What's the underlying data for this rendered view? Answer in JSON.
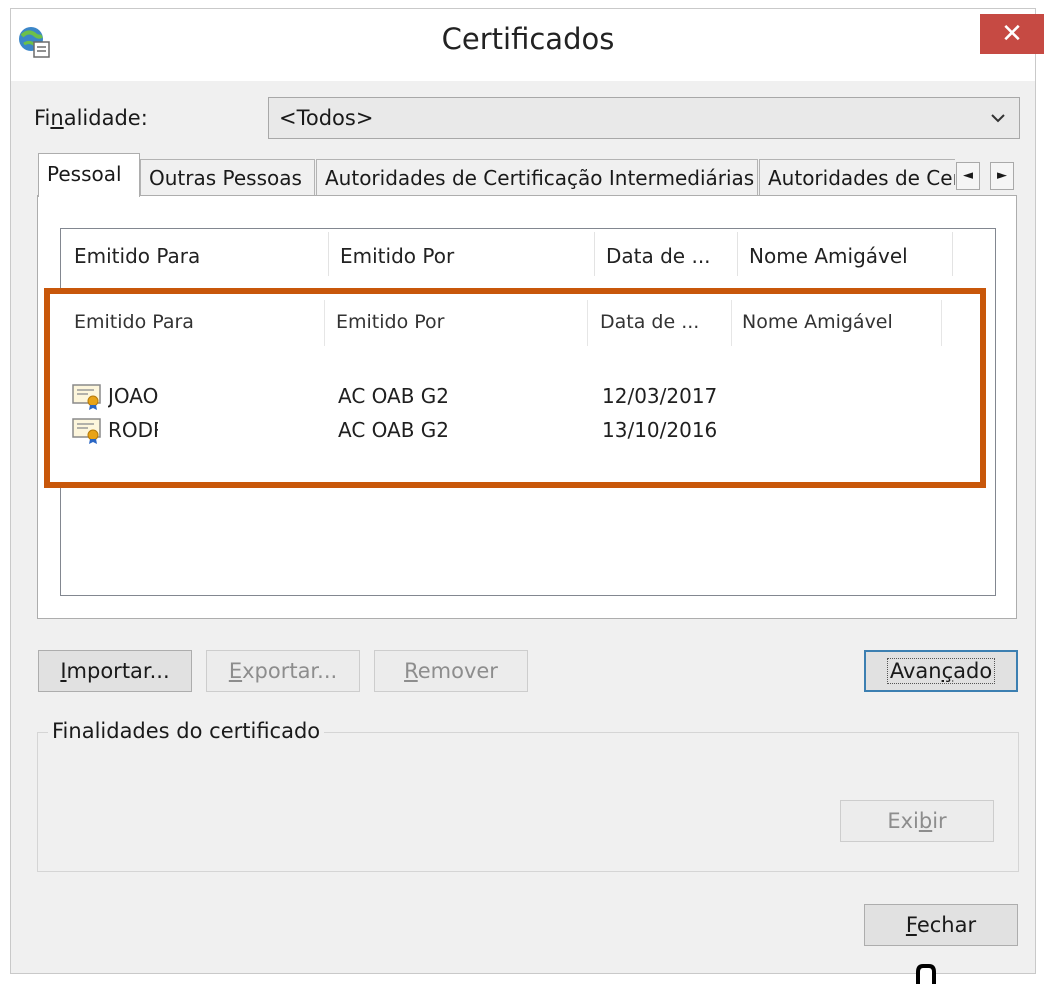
{
  "window": {
    "title": "Certificados",
    "close_glyph": "✕",
    "app_icon": "certificate-manager-icon"
  },
  "purpose": {
    "label_pre": "Fi",
    "label_mnemonic": "n",
    "label_post": "alidade:",
    "selected": "<Todos>",
    "chevron_icon": "chevron-down-icon"
  },
  "tabs": [
    {
      "label": "Pessoal",
      "active": true
    },
    {
      "label": "Outras Pessoas",
      "active": false
    },
    {
      "label": "Autoridades de Certificação Intermediárias",
      "active": false
    },
    {
      "label": "Autoridades de Certificação Raiz Confiáveis",
      "active": false
    }
  ],
  "tab_scroll": {
    "left": "◄",
    "right": "►"
  },
  "list": {
    "columns": [
      "Emitido Para",
      "Emitido Por",
      "Data de ...",
      "Nome Amigável"
    ],
    "rows": [
      {
        "issued_to": "JOAO",
        "issued_by": "AC OAB G2",
        "date": "12/03/2017",
        "friendly_name": ""
      },
      {
        "issued_to": "RODRIGO",
        "issued_by": "AC OAB G2",
        "date": "13/10/2016",
        "friendly_name": ""
      }
    ],
    "row_icon": "certificate-icon"
  },
  "highlight_color": "#c8570a",
  "buttons": {
    "import": {
      "mn": "I",
      "rest": "mportar..."
    },
    "export": {
      "mn": "E",
      "rest": "xportar..."
    },
    "remove": {
      "mn": "R",
      "rest": "emover"
    },
    "advanced": {
      "pre": "Avan",
      "mn": "ç",
      "post": "ado"
    },
    "view": {
      "pre": "Exi",
      "mn": "b",
      "post": "ir"
    },
    "close": {
      "mn": "F",
      "rest": "echar"
    }
  },
  "purposes_group": {
    "legend": "Finalidades do certificado"
  }
}
